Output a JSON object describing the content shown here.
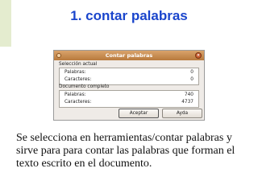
{
  "slide": {
    "title": "1. contar palabras",
    "description": "Se selecciona en herramientas/contar palabras y sirve para para contar las palabras que forman el texto escrito en el documento."
  },
  "dialog": {
    "window_title": "Contar palabras",
    "selection": {
      "header": "Selección actual",
      "rows": [
        {
          "label": "Palabras:",
          "value": "0"
        },
        {
          "label": "Caracteres:",
          "value": "0"
        }
      ]
    },
    "document": {
      "header": "Documento completo",
      "rows": [
        {
          "label": "Palabras:",
          "value": "740"
        },
        {
          "label": "Caracteres:",
          "value": "4737"
        }
      ]
    },
    "buttons": {
      "accept": "Aceptar",
      "help": "Ayda"
    }
  },
  "colors": {
    "title": "#1a45cc",
    "titlebar": "#c68a4d",
    "dialog_bg": "#efebe7"
  }
}
